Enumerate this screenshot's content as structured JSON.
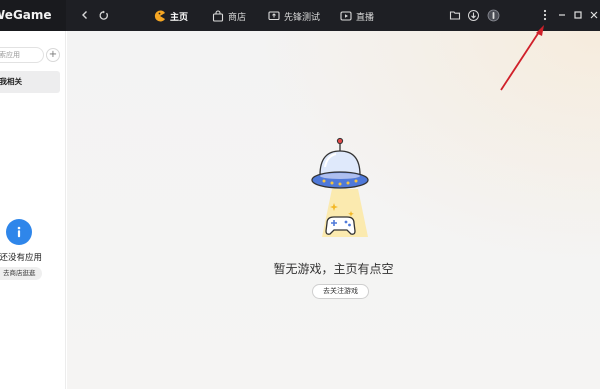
{
  "app": {
    "logo_text": "WeGame"
  },
  "titlebar": {
    "tabs": [
      {
        "label": "主页",
        "icon": "pacman-icon",
        "active": true
      },
      {
        "label": "商店",
        "icon": "bag-icon",
        "active": false
      },
      {
        "label": "先锋测试",
        "icon": "monitor-upload-icon",
        "active": false
      },
      {
        "label": "直播",
        "icon": "play-icon",
        "active": false
      }
    ],
    "right_icons": [
      "folder-icon",
      "download-icon",
      "avatar-icon"
    ],
    "window_controls": [
      "more-icon",
      "minimize-icon",
      "maximize-icon",
      "close-icon"
    ]
  },
  "sidebar": {
    "search_placeholder": "搜索应用",
    "active_item": "与我相关",
    "empty_message": "您还没有应用",
    "store_button": "去商店逛逛"
  },
  "main": {
    "empty_title": "暂无游戏，主页有点空",
    "follow_button": "去关注游戏"
  },
  "colors": {
    "titlebar": "#1e1f24",
    "accent_blue": "#2f86ea",
    "active_tab_icon": "#f5a623",
    "annotation_arrow": "#d0202a"
  }
}
